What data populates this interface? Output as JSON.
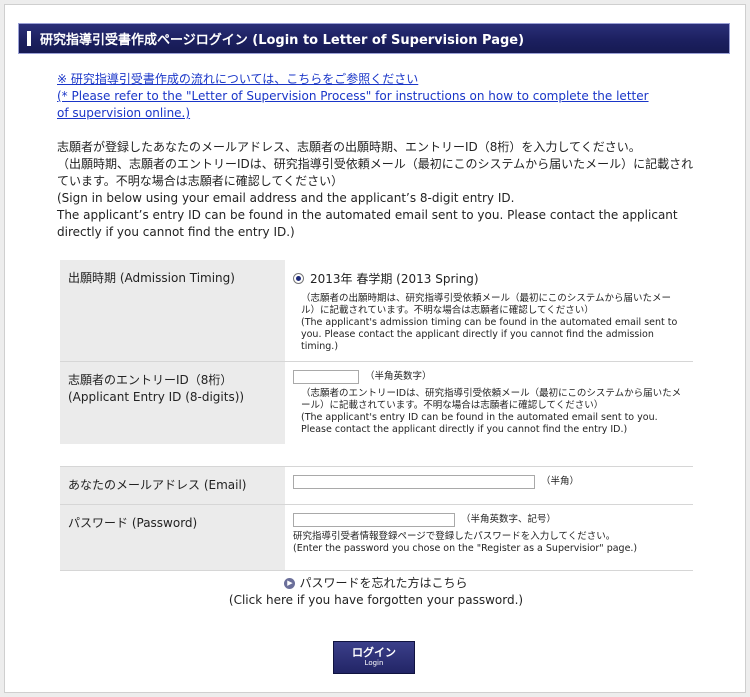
{
  "header": {
    "title": "研究指導引受書作成ページログイン (Login to Letter of Supervision Page)"
  },
  "links": {
    "jp": "※ 研究指導引受書作成の流れについては、こちらをご参照ください",
    "en": "(* Please refer to the \"Letter of Supervision Process\" for instructions on how to complete the letter of supervision online.)"
  },
  "intro": {
    "line1": "志願者が登録したあなたのメールアドレス、志願者の出願時期、エントリーID（8桁）を入力してください。",
    "line2": "（出願時期、志願者のエントリーIDは、研究指導引受依頼メール（最初にこのシステムから届いたメール）に記載されています。不明な場合は志願者に確認してください）",
    "line3": "(Sign in below using your email address and the applicant’s 8-digit entry ID.",
    "line4": "The applicant’s entry ID can be found in the automated email sent to you. Please contact the applicant directly if you cannot find the entry ID.)"
  },
  "form": {
    "admission": {
      "label": "出願時期 (Admission Timing)",
      "option": "2013年 春学期 (2013 Spring)",
      "note_jp": "（志願者の出願時期は、研究指導引受依頼メール（最初にこのシステムから届いたメール）に記載されています。不明な場合は志願者に確認してください）",
      "note_en": "(The applicant's admission timing can be found in the automated email sent to you. Please contact the applicant directly if you cannot find the admission timing.)"
    },
    "entry": {
      "label_jp": "志願者のエントリーID（8桁）",
      "label_en": "(Applicant Entry ID (8-digits))",
      "value": "",
      "hint": "（半角英数字）",
      "note_jp": "（志願者のエントリーIDは、研究指導引受依頼メール（最初にこのシステムから届いたメール）に記載されています。不明な場合は志願者に確認してください）",
      "note_en": "(The applicant's entry ID can be found in the automated email sent to you. Please contact the applicant directly if you cannot find the entry ID.)"
    },
    "email": {
      "label": "あなたのメールアドレス (Email)",
      "value": "",
      "hint": "（半角）"
    },
    "password": {
      "label": "パスワード (Password)",
      "value": "",
      "hint": "（半角英数字、記号）",
      "note_jp": "研究指導引受者情報登録ページで登録したパスワードを入力してください。",
      "note_en": "(Enter the password you chose on the \"Register as a Supervisior\" page.)"
    }
  },
  "forgot": {
    "jp": "パスワードを忘れた方はこちら",
    "en": "(Click here if you have forgotten your password.)"
  },
  "login_button": {
    "jp": "ログイン",
    "en": "Login"
  }
}
